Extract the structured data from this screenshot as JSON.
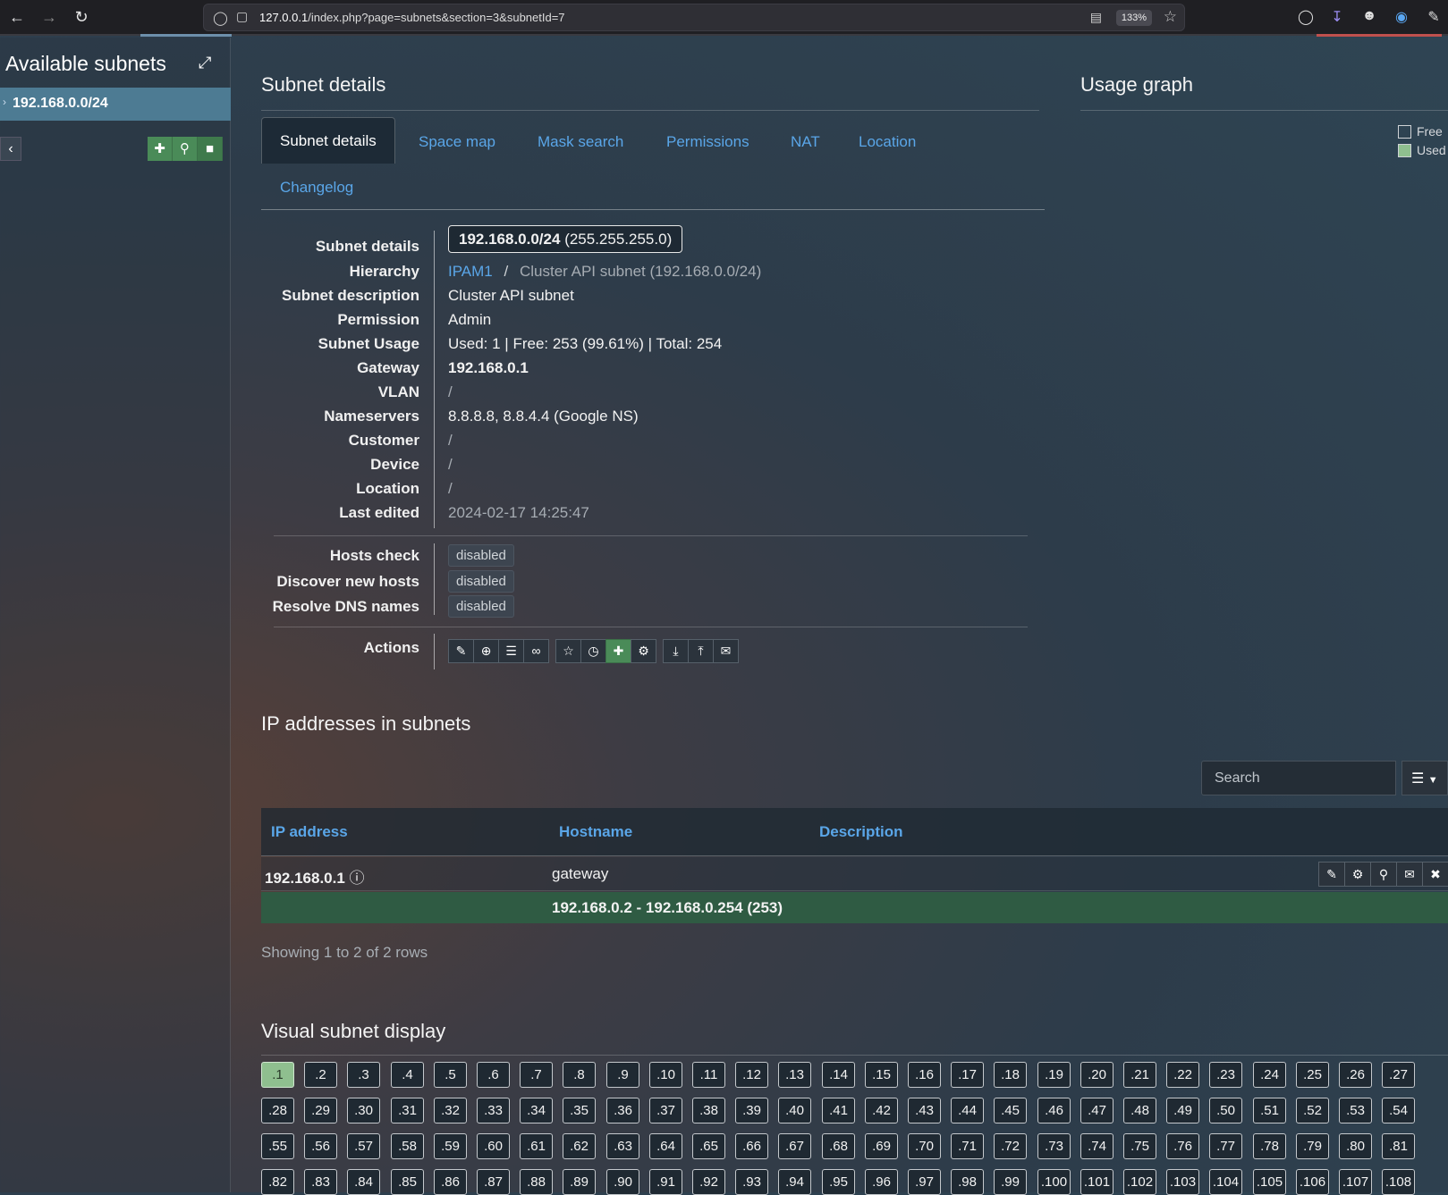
{
  "browser": {
    "url_host": "127.0.0.1",
    "url_path": "/index.php?page=subnets&section=3&subnetId=7",
    "zoom": "133%"
  },
  "sidebar": {
    "title": "Available subnets",
    "subnet": "192.168.0.0/24"
  },
  "subnet_details": {
    "title": "Subnet details",
    "tabs": [
      "Subnet details",
      "Space map",
      "Mask search",
      "Permissions",
      "NAT",
      "Location",
      "Changelog"
    ],
    "fields": {
      "subnet_label": "Subnet details",
      "subnet_cidr": "192.168.0.0/24",
      "subnet_mask": "(255.255.255.0)",
      "hierarchy_label": "Hierarchy",
      "hierarchy_link": "IPAM1",
      "hierarchy_sep": "/",
      "hierarchy_current": "Cluster API subnet (192.168.0.0/24)",
      "description_label": "Subnet description",
      "description": "Cluster API subnet",
      "permission_label": "Permission",
      "permission": "Admin",
      "usage_label": "Subnet Usage",
      "usage": "Used: 1 | Free: 253 (99.61%) | Total: 254",
      "gateway_label": "Gateway",
      "gateway": "192.168.0.1",
      "vlan_label": "VLAN",
      "vlan": "/",
      "nameservers_label": "Nameservers",
      "nameservers": "8.8.8.8, 8.8.4.4 (Google NS)",
      "customer_label": "Customer",
      "customer": "/",
      "device_label": "Device",
      "device": "/",
      "location_label": "Location",
      "location": "/",
      "last_edited_label": "Last edited",
      "last_edited": "2024-02-17 14:25:47",
      "hosts_check_label": "Hosts check",
      "hosts_check": "disabled",
      "discover_label": "Discover new hosts",
      "discover": "disabled",
      "resolve_label": "Resolve DNS names",
      "resolve": "disabled",
      "actions_label": "Actions"
    }
  },
  "usage_graph": {
    "title": "Usage graph",
    "legend_free": "Free",
    "legend_used": "Used"
  },
  "ip_addresses": {
    "title": "IP addresses in subnets",
    "search_placeholder": "Search",
    "columns": [
      "IP address",
      "Hostname",
      "Description"
    ],
    "row1": {
      "ip": "192.168.0.1",
      "hostname": "gateway"
    },
    "row2": {
      "range": "192.168.0.2 - 192.168.0.254 (253)"
    },
    "showing": "Showing 1 to 2 of 2 rows"
  },
  "visual": {
    "title": "Visual subnet display",
    "cells_visible": 108,
    "used_cells": [
      1
    ]
  },
  "colors": {
    "link": "#5aa6e8",
    "used": "#8fbf8f",
    "free_range_row": "#2f5b43",
    "sidebar_active": "#4d7b93"
  }
}
